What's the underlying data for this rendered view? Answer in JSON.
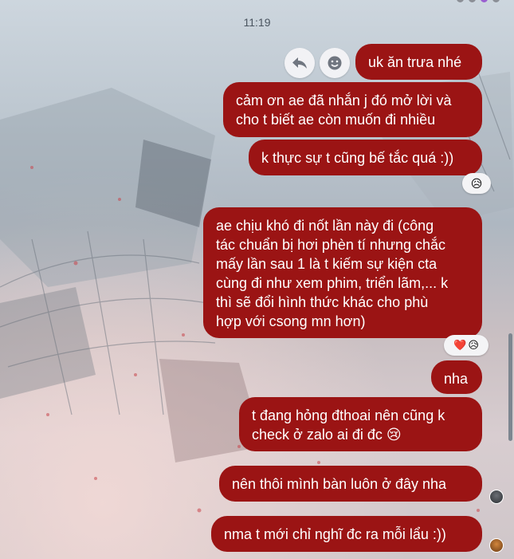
{
  "timestamp": "11:19",
  "colors": {
    "bubble": "#9b1414",
    "bubble_text": "#ffffff",
    "reaction_bg": "#f4f4f6"
  },
  "message_actions": {
    "reply": "reply-icon",
    "react": "emoji-icon"
  },
  "messages": [
    {
      "text": "uk ăn trưa nhé"
    },
    {
      "text": "cảm ơn ae đã nhắn j đó mở lời và\ncho t biết ae còn muốn đi nhiều"
    },
    {
      "text": "k thực sự t cũng bế tắc quá :))",
      "reactions": [
        "😥"
      ]
    },
    {
      "text": "ae chịu khó đi nốt lần này đi (công\ntác chuẩn bị hơi phèn tí nhưng chắc\nmấy lần sau 1 là t kiếm sự kiện cta\ncùng đi như xem phim, triển lãm,... k\nthì sẽ đổi hình thức khác cho phù\nhợp với csong mn hơn)",
      "reactions": [
        "❤️",
        "😥"
      ]
    },
    {
      "text": "nha"
    },
    {
      "text": "t đang hỏng đthoai nên cũng k\ncheck ở zalo ai đi đc 😢"
    },
    {
      "text": "nên thôi mình bàn luôn ở đây nha"
    },
    {
      "text": "nma t mới chỉ nghĩ đc ra mỗi lẩu :))"
    }
  ]
}
